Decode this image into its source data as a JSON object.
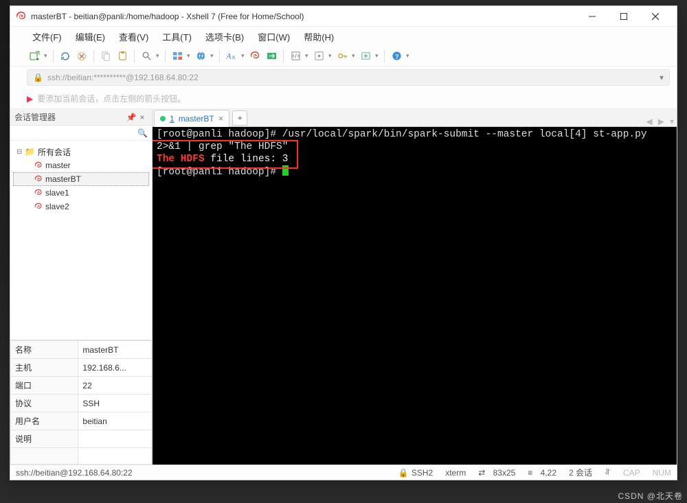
{
  "window": {
    "title": "masterBT - beitian@panli:/home/hadoop - Xshell 7 (Free for Home/School)"
  },
  "menu": {
    "file": "文件(F)",
    "edit": "编辑(E)",
    "view": "查看(V)",
    "tools": "工具(T)",
    "tab": "选项卡(B)",
    "window": "窗口(W)",
    "help": "帮助(H)"
  },
  "address": {
    "url": "ssh://beitian:**********@192.168.64.80:22"
  },
  "hint": {
    "text": "要添加当前会话，点击左侧的箭头按钮。"
  },
  "sidebar": {
    "title": "会话管理器",
    "root": "所有会话",
    "items": [
      {
        "label": "master"
      },
      {
        "label": "masterBT"
      },
      {
        "label": "slave1"
      },
      {
        "label": "slave2"
      }
    ],
    "selected_index": 1,
    "props": {
      "name_k": "名称",
      "name_v": "masterBT",
      "host_k": "主机",
      "host_v": "192.168.6...",
      "port_k": "端口",
      "port_v": "22",
      "proto_k": "协议",
      "proto_v": "SSH",
      "user_k": "用户名",
      "user_v": "beitian",
      "desc_k": "说明",
      "desc_v": ""
    }
  },
  "tabs": {
    "active_num": "1",
    "active_label": "masterBT"
  },
  "terminal": {
    "line1_prompt": "[root@panli hadoop]# ",
    "line1_cmd": "/usr/local/spark/bin/spark-submit --master local[4] st-app.py ",
    "line2": "2>&1 | grep \"The HDFS\"",
    "line3_a": "The HDFS",
    "line3_b": " file lines: 3",
    "line4_prompt": "[root@panli hadoop]# "
  },
  "status": {
    "conn": "ssh://beitian@192.168.64.80:22",
    "proto": "SSH2",
    "termtype": "xterm",
    "size": "83x25",
    "pos": "4,22",
    "sessions": "2 会话",
    "cap": "CAP",
    "num": "NUM"
  },
  "watermark": "CSDN @北天卷"
}
